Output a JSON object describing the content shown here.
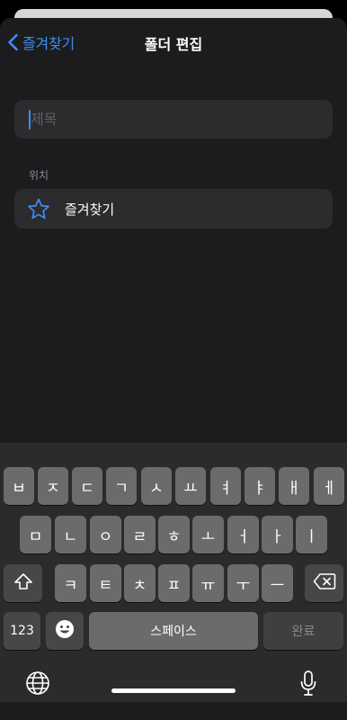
{
  "nav": {
    "back_label": "즐겨찾기",
    "title": "폴더 편집"
  },
  "title_field": {
    "placeholder": "제목",
    "value": ""
  },
  "location_section": {
    "label": "위치",
    "row_label": "즐겨찾기",
    "icon": "star-icon"
  },
  "keyboard": {
    "row1": [
      "ㅂ",
      "ㅈ",
      "ㄷ",
      "ㄱ",
      "ㅅ",
      "ㅛ",
      "ㅕ",
      "ㅑ",
      "ㅐ",
      "ㅔ"
    ],
    "row2": [
      "ㅁ",
      "ㄴ",
      "ㅇ",
      "ㄹ",
      "ㅎ",
      "ㅗ",
      "ㅓ",
      "ㅏ",
      "ㅣ"
    ],
    "row3": [
      "ㅋ",
      "ㅌ",
      "ㅊ",
      "ㅍ",
      "ㅠ",
      "ㅜ",
      "ㅡ"
    ],
    "numbers_label": "123",
    "space_label": "스페이스",
    "done_label": "완료",
    "icons": {
      "shift": "shift-icon",
      "delete": "delete-icon",
      "emoji": "emoji-icon",
      "globe": "globe-icon",
      "mic": "microphone-icon"
    }
  },
  "colors": {
    "accent": "#3b8ef0",
    "sheet_bg": "#1c1c1e",
    "field_bg": "#2c2c2e",
    "keyboard_bg": "#2b2b2b",
    "key_bg": "#6b6b6b",
    "key_dark_bg": "#474747"
  }
}
